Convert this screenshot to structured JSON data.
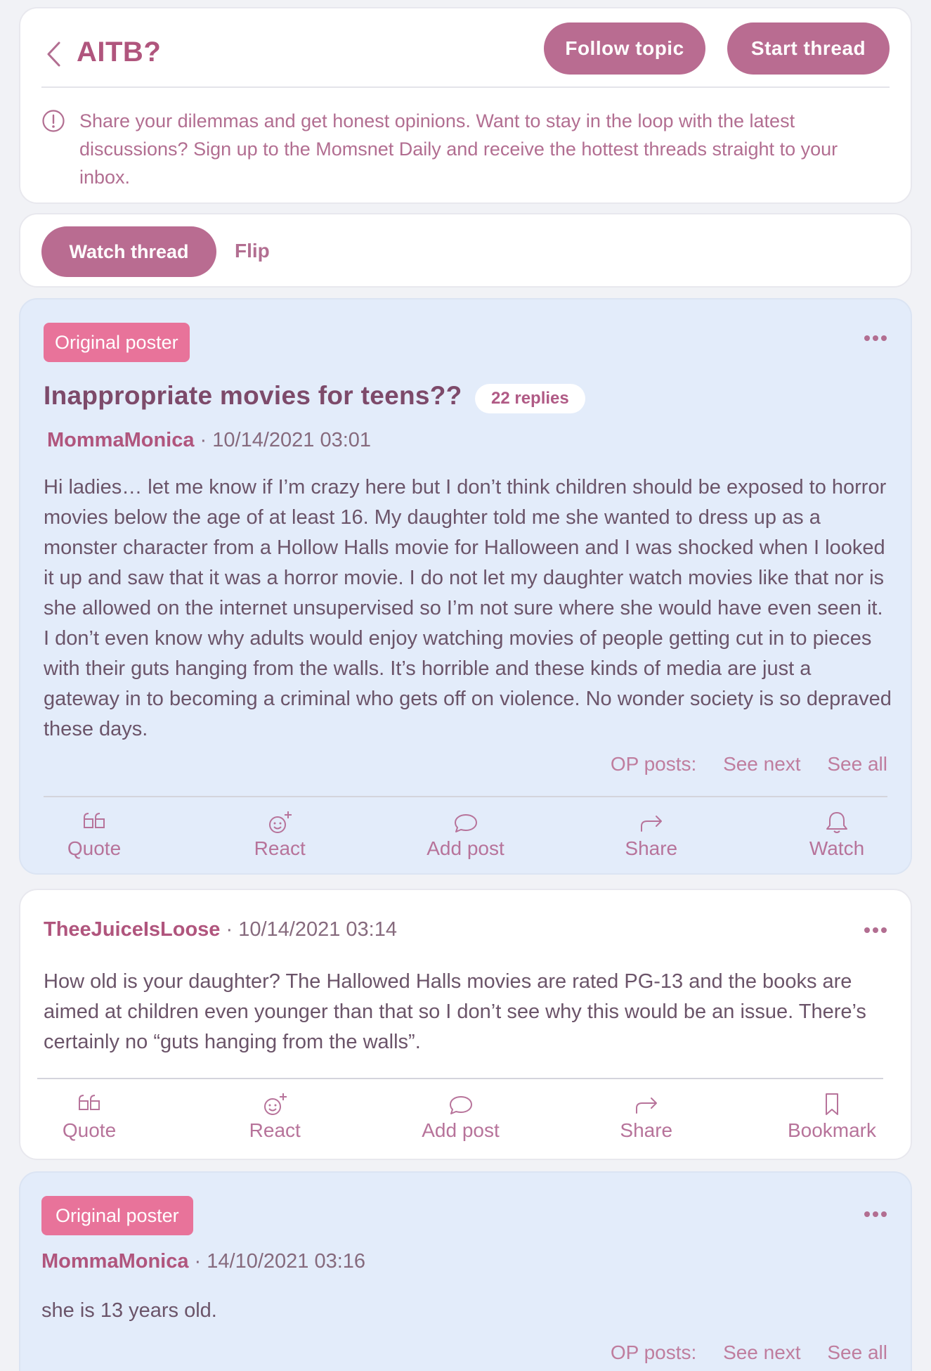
{
  "header": {
    "title": "AITB?",
    "follow_label": "Follow topic",
    "start_label": "Start thread",
    "info_prefix": "Share your dilemmas and get honest opinions. Want to stay in the loop with the latest discussions? ",
    "info_link": "Sign up to the Momsnet Daily",
    "info_suffix": " and receive the hottest threads straight to your inbox."
  },
  "thread_actions": {
    "watch_label": "Watch thread",
    "flip_label": "Flip"
  },
  "posts": [
    {
      "badge": "Original poster",
      "title": "Inappropriate movies for teens??",
      "replies": "22 replies",
      "author": "MommaMonica",
      "timestamp": "· 10/14/2021 03:01",
      "body": "Hi ladies… let me know if I’m crazy here but I don’t think children should be exposed to horror movies below the age of at least 16. My daughter told me she wanted to dress up as a monster character from a Hollow Halls movie for Halloween and I was shocked when I looked it up and saw that it was a horror movie. I do not let my daughter watch movies like that nor is she allowed on the internet unsupervised so I’m not sure where she would have even seen it. I don’t even know why adults would enjoy watching movies of people getting cut in to pieces with their guts hanging from the walls. It’s horrible and these kinds of media are just a gateway in to becoming a criminal who gets off on violence. No wonder society is so depraved these days.",
      "op_links": {
        "label": "OP posts:",
        "next": "See next",
        "all": "See all"
      },
      "actions": [
        "Quote",
        "React",
        "Add post",
        "Share",
        "Watch"
      ]
    },
    {
      "author": "TheeJuiceIsLoose",
      "timestamp": "· 10/14/2021 03:14",
      "body": "How old is your daughter? The Hallowed Halls movies are rated PG-13 and the books are aimed at children even younger than that so I don’t see why this would be an issue. There’s certainly no “guts hanging from the walls”.",
      "actions": [
        "Quote",
        "React",
        "Add post",
        "Share",
        "Bookmark"
      ]
    },
    {
      "badge": "Original poster",
      "author": "MommaMonica",
      "timestamp": "· 14/10/2021 03:16",
      "body": "she is 13 years old.",
      "op_links": {
        "label": "OP posts:",
        "next": "See next",
        "all": "See all"
      }
    }
  ],
  "icons": {
    "back": "chevron-left-icon",
    "info": "info-circle-icon",
    "more": "more-dots-icon",
    "quote": "quote-icon",
    "react": "emoji-plus-icon",
    "add_post": "speech-bubble-icon",
    "share": "share-arrow-icon",
    "watch": "bell-icon",
    "bookmark": "bookmark-icon"
  },
  "colors": {
    "brand": "#b96c91",
    "op_badge": "#e8739a",
    "op_background": "#e3ecfa",
    "page_background": "#f1f2f6"
  }
}
